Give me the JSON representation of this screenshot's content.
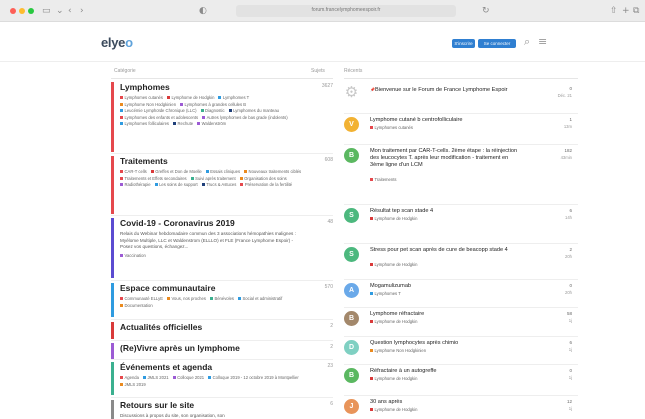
{
  "browser": {
    "url": "forum.francelymphomeespoir.fr",
    "nav_icons": {
      "sidebar": "sidebar-icon",
      "back": "chevron-left-icon",
      "forward": "chevron-right-icon",
      "shield": "shield-icon",
      "reload": "reload-icon",
      "share": "share-icon",
      "new_tab": "plus-icon",
      "tabs": "tabs-icon"
    }
  },
  "header": {
    "logo_text": "elye",
    "logo_accent": "o",
    "signup_label": "S'inscrire",
    "login_label": "Se connecter",
    "search_icon": "search-icon",
    "menu_icon": "hamburger-menu-icon"
  },
  "columns": {
    "category": "Catégorie",
    "topics": "Sujets",
    "latest": "Récents"
  },
  "categories": [
    {
      "title": "Lymphomes",
      "count": "3627",
      "color": "#e5484d",
      "description": "",
      "tags": [
        {
          "label": "Lymphomes cutanés",
          "color": "#e5484d"
        },
        {
          "label": "Lymphome de Hodgkin",
          "color": "#d93a3a"
        },
        {
          "label": "Lymphomes T",
          "color": "#2f9be0"
        },
        {
          "label": "Lymphome Non Hodgkinien",
          "color": "#ea8a1e"
        },
        {
          "label": "Lymphomes à grandes cellules B",
          "color": "#9c5bd4"
        },
        {
          "label": "Leucémie Lymphoïde Chronique (LLC)",
          "color": "#2f9be0"
        },
        {
          "label": "Diagnostic",
          "color": "#3bb08f"
        },
        {
          "label": "Lymphomes du manteau",
          "color": "#1f3f7a"
        },
        {
          "label": "Lymphomes des enfants et adolescents",
          "color": "#e5484d"
        },
        {
          "label": "Autres lymphomes de bas grade (indolents)",
          "color": "#9c5bd4"
        },
        {
          "label": "Lymphomes folliculaires",
          "color": "#2f9be0"
        },
        {
          "label": "Rechute",
          "color": "#1f3f7a"
        },
        {
          "label": "Waldenström",
          "color": "#9c5bd4"
        }
      ]
    },
    {
      "title": "Traitements",
      "count": "608",
      "color": "#e5484d",
      "description": "",
      "tags": [
        {
          "label": "CAR-T cells",
          "color": "#e5484d"
        },
        {
          "label": "Greffes et Don de Moelle",
          "color": "#d93a3a"
        },
        {
          "label": "Essais cliniques",
          "color": "#2f9be0"
        },
        {
          "label": "Nouveaux traitements ciblés",
          "color": "#ea8a1e"
        },
        {
          "label": "Traitements et Effets secondaires",
          "color": "#e5484d"
        },
        {
          "label": "Suivi après traitement",
          "color": "#3bb08f"
        },
        {
          "label": "Organisation des soins",
          "color": "#ea8a1e"
        },
        {
          "label": "Radiothérapie",
          "color": "#9c5bd4"
        },
        {
          "label": "Les soins de support",
          "color": "#2f9be0"
        },
        {
          "label": "Trucs & Astuces",
          "color": "#1f3f7a"
        },
        {
          "label": "Préservation de la fertilité",
          "color": "#e5484d"
        }
      ]
    },
    {
      "title": "Covid-19 - Coronavirus 2019",
      "count": "48",
      "color": "#5b4bd1",
      "description": "Relais du Webinar hebdomadaire commun des 3 associations hémopathies malignes : Myélome Multiple, LLC et Waldenstrom (ELLLO) et FLE (France Lymphome Espoir) - Posez vos questions, échangez...",
      "tags": [
        {
          "label": "Vaccination",
          "color": "#9c5bd4"
        }
      ]
    },
    {
      "title": "Espace communautaire",
      "count": "570",
      "color": "#2f9be0",
      "description": "",
      "tags": [
        {
          "label": "Communauté ELLyE",
          "color": "#e5484d"
        },
        {
          "label": "Vous, nos proches",
          "color": "#ea8a1e"
        },
        {
          "label": "Bénévoles",
          "color": "#3bb08f"
        },
        {
          "label": "Social et administratif",
          "color": "#2f9be0"
        },
        {
          "label": "Documentation",
          "color": "#ea8a1e"
        }
      ]
    },
    {
      "title": "Actualités officielles",
      "count": "2",
      "color": "#d93a3a",
      "description": "",
      "tags": []
    },
    {
      "title": "(Re)Vivre après un lymphome",
      "count": "2",
      "color": "#9c5bd4",
      "description": "",
      "tags": []
    },
    {
      "title": "Événements et agenda",
      "count": "23",
      "color": "#3bb08f",
      "description": "",
      "tags": [
        {
          "label": "Agenda",
          "color": "#e5484d"
        },
        {
          "label": "JMLS 2021",
          "color": "#2f9be0"
        },
        {
          "label": "Colloque 2021",
          "color": "#9c5bd4"
        },
        {
          "label": "Colloque 2019 - 12 octobre 2019 à Montpellier",
          "color": "#2f9be0"
        },
        {
          "label": "JMLS 2019",
          "color": "#ea8a1e"
        }
      ]
    },
    {
      "title": "Retours sur le site",
      "count": "6",
      "color": "#8a8a8a",
      "description": "Discussions à propos du site, son organisation, son",
      "tags": []
    }
  ],
  "topics": [
    {
      "title": "Bienvenue sur le Forum de France Lymphome Espoir",
      "pinned": true,
      "tag": "",
      "tag_color": "",
      "replies": "0",
      "age": "Déc. 21",
      "avatar": "",
      "avatar_color": ""
    },
    {
      "title": "Lymphome cutané b centrofolliculaire",
      "tag": "Lymphomes cutanés",
      "tag_color": "#e5484d",
      "replies": "1",
      "age": "13m",
      "avatar": "V",
      "avatar_color": "#f2b233"
    },
    {
      "title": "Mon traitement par CAR-T-cells. 2ème étape : la réinjection des leucocytes T. après leur modification - traitement en 3ème ligne d'un LCM",
      "tag": "Traitements",
      "tag_color": "#e5484d",
      "replies": "182",
      "age": "43min",
      "avatar": "B",
      "avatar_color": "#5bb861"
    },
    {
      "title": "Résultat tep scan stade 4",
      "tag": "Lymphome de Hodgkin",
      "tag_color": "#d93a3a",
      "replies": "6",
      "age": "14h",
      "avatar": "S",
      "avatar_color": "#4cb87e"
    },
    {
      "title": "Stress pour pet scan après de cure de beacopp stade 4",
      "tag": "Lymphome de Hodgkin",
      "tag_color": "#d93a3a",
      "replies": "2",
      "age": "20h",
      "avatar": "S",
      "avatar_color": "#4cb87e"
    },
    {
      "title": "Mogamulizumab",
      "tag": "Lymphomes T",
      "tag_color": "#2f9be0",
      "replies": "0",
      "age": "20h",
      "avatar": "A",
      "avatar_color": "#6aa9e9"
    },
    {
      "title": "Lymphome réfractaire",
      "tag": "Lymphome de Hodgkin",
      "tag_color": "#d93a3a",
      "replies": "58",
      "age": "1j",
      "avatar": "B",
      "avatar_color": "#a3886b"
    },
    {
      "title": "Question lymphocytes après chimio",
      "tag": "Lymphome Non Hodgkinien",
      "tag_color": "#ea8a1e",
      "replies": "6",
      "age": "1j",
      "avatar": "D",
      "avatar_color": "#7fd0c2"
    },
    {
      "title": "Réfractaire à un autogreffe",
      "tag": "Lymphome de Hodgkin",
      "tag_color": "#d93a3a",
      "replies": "0",
      "age": "1j",
      "avatar": "B",
      "avatar_color": "#5bb861"
    },
    {
      "title": "30 ans après",
      "tag": "Lymphome de Hodgkin",
      "tag_color": "#d93a3a",
      "replies": "12",
      "age": "1j",
      "avatar": "J",
      "avatar_color": "#e8945a"
    }
  ]
}
